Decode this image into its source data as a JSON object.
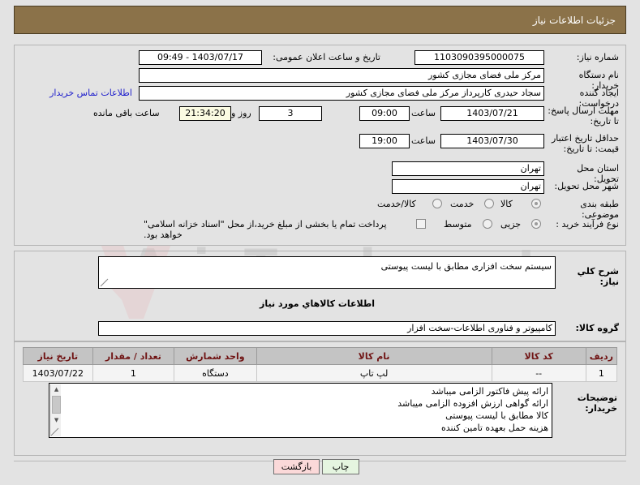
{
  "header": {
    "title": "جزئیات اطلاعات نیاز"
  },
  "watermark": {
    "text": "AriaTender.net"
  },
  "form": {
    "need_number_label": "شماره نیاز:",
    "need_number_value": "1103090395000075",
    "announce_label": "تاریخ و ساعت اعلان عمومی:",
    "announce_value": "1403/07/17 - 09:49",
    "buyer_org_label": "نام دستگاه خریدار:",
    "buyer_org_value": "مرکز ملی فضای مجازی کشور",
    "requester_label": "ایجاد کننده درخواست:",
    "requester_value": "سجاد حیدری کارپرداز مرکز ملی فضای مجازی کشور",
    "contact_link": "اطلاعات تماس خریدار",
    "deadline_label": "مهلت ارسال پاسخ: تا تاریخ:",
    "deadline_date": "1403/07/21",
    "deadline_time_label": "ساعت",
    "deadline_time": "09:00",
    "days_value": "3",
    "days_label": "روز و",
    "countdown_value": "21:34:20",
    "countdown_label": "ساعت باقی مانده",
    "validity_label": "حداقل تاریخ اعتبار قیمت: تا تاریخ:",
    "validity_date": "1403/07/30",
    "validity_time_label": "ساعت",
    "validity_time": "19:00",
    "province_label": "استان محل تحویل:",
    "province_value": "تهران",
    "city_label": "شهر محل تحویل:",
    "city_value": "تهران",
    "category_label": "طبقه بندی موضوعی:",
    "category_options": [
      {
        "label": "کالا",
        "selected": true
      },
      {
        "label": "خدمت",
        "selected": false
      },
      {
        "label": "کالا/خدمت",
        "selected": false
      }
    ],
    "process_label": "نوع فرآیند خرید :",
    "process_options": [
      {
        "label": "جزیی",
        "selected": true
      },
      {
        "label": "متوسط",
        "selected": false
      }
    ],
    "treasury_checkbox_label": "پرداخت تمام یا بخشی از مبلغ خرید،از محل \"اسناد خزانه اسلامی\" خواهد بود.",
    "treasury_checked": false
  },
  "description": {
    "label": "شرح کلي نیاز:",
    "value": "سیستم سخت افزاری مطابق با لیست پیوستی"
  },
  "goods_section": {
    "title": "اطلاعات کالاهاي مورد نیاز",
    "group_label": "گروه کالا:",
    "group_value": "کامپیوتر و فناوری اطلاعات-سخت افزار"
  },
  "items_table": {
    "columns": [
      "ردیف",
      "کد کالا",
      "نام کالا",
      "واحد شمارش",
      "تعداد / مقدار",
      "تاریخ نیاز"
    ],
    "rows": [
      {
        "row": "1",
        "code": "--",
        "name": "لپ تاپ",
        "unit": "دستگاه",
        "qty": "1",
        "date": "1403/07/22"
      }
    ]
  },
  "buyer_notes": {
    "label": "توضیحات خریدار:",
    "lines": [
      "ارائه پیش فاکتور الزامی میباشد",
      "ارائه گواهی ارزش افزوده الزامی میباشد",
      "کالا مطابق با لیست پیوستی",
      "هزینه حمل بعهده تامین کننده"
    ]
  },
  "footer": {
    "print_label": "چاپ",
    "back_label": "بازگشت"
  }
}
